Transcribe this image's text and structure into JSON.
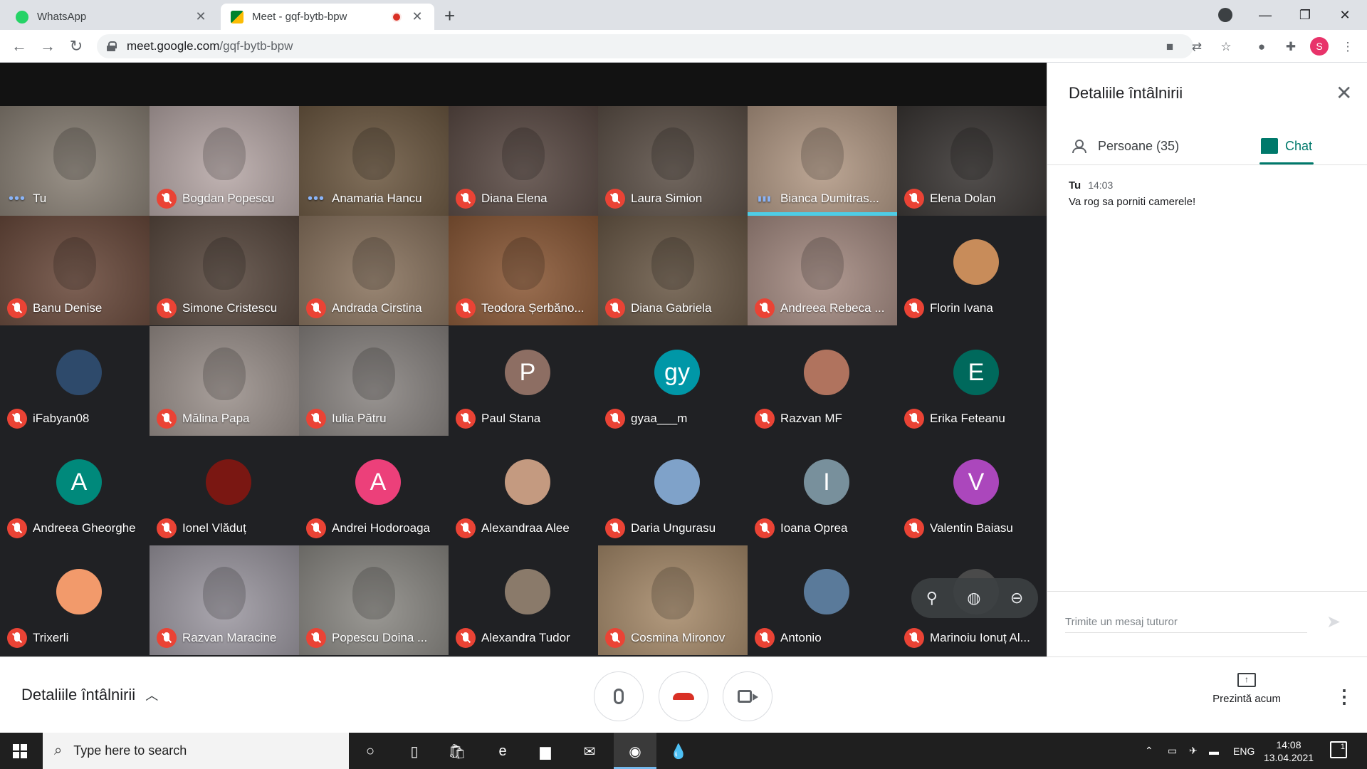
{
  "browser": {
    "tabs": [
      {
        "title": "WhatsApp",
        "active": false
      },
      {
        "title": "Meet - gqf-bytb-bpw",
        "active": true
      }
    ],
    "url_host": "meet.google.com",
    "url_path": "/gqf-bytb-bpw",
    "profile_initial": "S"
  },
  "meet": {
    "participants": [
      {
        "name": "Tu",
        "status": "dots",
        "video": true,
        "bg": "#8a8176"
      },
      {
        "name": "Bogdan Popescu",
        "status": "muted",
        "video": true,
        "bg": "#b8a9a8"
      },
      {
        "name": "Anamaria Hancu",
        "status": "dots",
        "video": true,
        "bg": "#6e5a43"
      },
      {
        "name": "Diana Elena",
        "status": "muted",
        "video": true,
        "bg": "#5b4b45"
      },
      {
        "name": "Laura Simion",
        "status": "muted",
        "video": true,
        "bg": "#5d5148"
      },
      {
        "name": "Bianca Dumitras...",
        "status": "speaking",
        "video": true,
        "bg": "#b39a86",
        "speaking": true
      },
      {
        "name": "Elena Dolan",
        "status": "muted",
        "video": true,
        "bg": "#3a3634"
      },
      {
        "name": "Banu Denise",
        "status": "muted",
        "video": true,
        "bg": "#6b4b3d"
      },
      {
        "name": "Simone Cristescu",
        "status": "muted",
        "video": true,
        "bg": "#5a4a40"
      },
      {
        "name": "Andrada Cirstina",
        "status": "muted",
        "video": true,
        "bg": "#8b7560"
      },
      {
        "name": "Teodora Șerbăno...",
        "status": "muted",
        "video": true,
        "bg": "#8c5a38"
      },
      {
        "name": "Diana Gabriela",
        "status": "muted",
        "video": true,
        "bg": "#6b5a48"
      },
      {
        "name": "Andreea Rebeca ...",
        "status": "muted",
        "video": true,
        "bg": "#a68c83"
      },
      {
        "name": "Florin Ivana",
        "status": "muted",
        "video": false,
        "avatar": "",
        "avatar_color": "#c88c5a"
      },
      {
        "name": "iFabyan08",
        "status": "muted",
        "video": false,
        "avatar": "",
        "avatar_color": "#2e4a6b"
      },
      {
        "name": "Mălina Papa",
        "status": "muted",
        "video": true,
        "bg": "#9c928d"
      },
      {
        "name": "Iulia Pătru",
        "status": "muted",
        "video": true,
        "bg": "#8a8582"
      },
      {
        "name": "Paul Stana",
        "status": "muted",
        "video": false,
        "avatar": "P",
        "avatar_color": "#8d6e63"
      },
      {
        "name": "gyaa___m",
        "status": "muted",
        "video": false,
        "avatar": "gy",
        "avatar_color": "#0097a7"
      },
      {
        "name": "Razvan MF",
        "status": "muted",
        "video": false,
        "avatar": "",
        "avatar_color": "#b0735e"
      },
      {
        "name": "Erika Feteanu",
        "status": "muted",
        "video": false,
        "avatar": "E",
        "avatar_color": "#00695c"
      },
      {
        "name": "Andreea Gheorghe",
        "status": "muted",
        "video": false,
        "avatar": "A",
        "avatar_color": "#00897b"
      },
      {
        "name": "Ionel Vlăduț",
        "status": "muted",
        "video": false,
        "avatar": "",
        "avatar_color": "#7a1712"
      },
      {
        "name": "Andrei Hodoroaga",
        "status": "muted",
        "video": false,
        "avatar": "A",
        "avatar_color": "#ec407a"
      },
      {
        "name": "Alexandraa Alee",
        "status": "muted",
        "video": false,
        "avatar": "",
        "avatar_color": "#c49a80"
      },
      {
        "name": "Daria Ungurasu",
        "status": "muted",
        "video": false,
        "avatar": "",
        "avatar_color": "#7fa2c9"
      },
      {
        "name": "Ioana Oprea",
        "status": "muted",
        "video": false,
        "avatar": "I",
        "avatar_color": "#78909c"
      },
      {
        "name": "Valentin Baiasu",
        "status": "muted",
        "video": false,
        "avatar": "V",
        "avatar_color": "#ab47bc"
      },
      {
        "name": "Trixerli",
        "status": "muted",
        "video": false,
        "avatar": "",
        "avatar_color": "#f29a6b"
      },
      {
        "name": "Razvan Maracine",
        "status": "muted",
        "video": true,
        "bg": "#9e9aa3"
      },
      {
        "name": "Popescu Doina ...",
        "status": "muted",
        "video": true,
        "bg": "#8c8a85"
      },
      {
        "name": "Alexandra Tudor",
        "status": "muted",
        "video": false,
        "avatar": "",
        "avatar_color": "#8a7a6a"
      },
      {
        "name": "Cosmina Mironov",
        "status": "muted",
        "video": true,
        "bg": "#a88c6c"
      },
      {
        "name": "Antonio",
        "status": "muted",
        "video": false,
        "avatar": "",
        "avatar_color": "#5a7a9a"
      },
      {
        "name": "Marinoiu Ionuț Al...",
        "status": "muted",
        "video": false,
        "avatar": "",
        "avatar_color": "#4a4a4a",
        "hover": true
      }
    ]
  },
  "panel": {
    "title": "Detaliile întâlnirii",
    "people_tab": "Persoane (35)",
    "chat_tab": "Chat",
    "message": {
      "sender": "Tu",
      "time": "14:03",
      "text": "Va rog sa porniti camerele!"
    },
    "input_placeholder": "Trimite un mesaj tuturor"
  },
  "bottom": {
    "details_label": "Detaliile întâlnirii",
    "present_label": "Prezintă acum"
  },
  "taskbar": {
    "search_placeholder": "Type here to search",
    "lang": "ENG",
    "time": "14:08",
    "date": "13.04.2021",
    "notif_count": "1"
  },
  "colors": {
    "meet_bg": "#202124",
    "mute_red": "#ea4335",
    "chat_green": "#00796b",
    "speaking_cyan": "#4ecde6"
  }
}
